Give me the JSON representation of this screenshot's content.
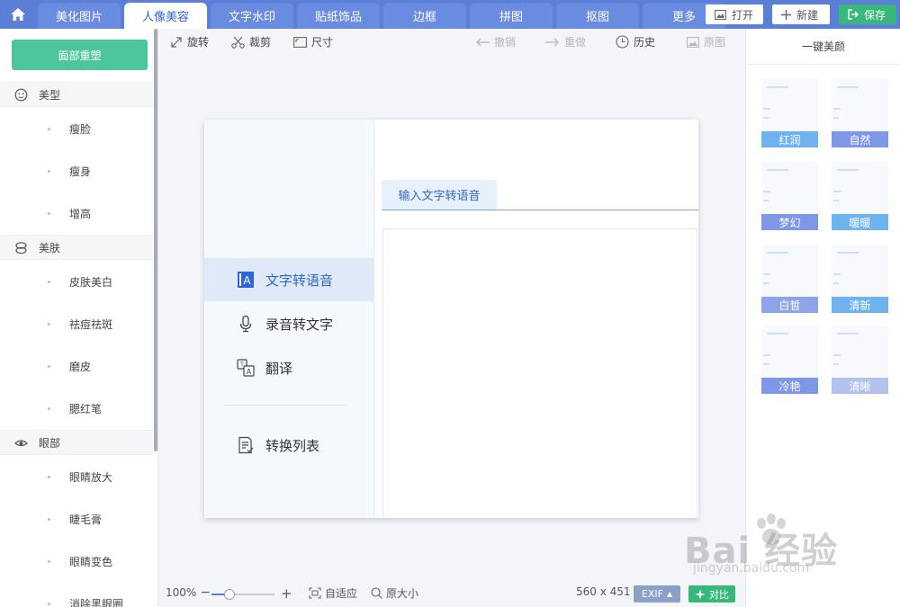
{
  "header": {
    "tabs": [
      "美化图片",
      "人像美容",
      "文字水印",
      "贴纸饰品",
      "边框",
      "拼图",
      "抠图",
      "更多"
    ],
    "active_tab_index": 1,
    "open_label": "打开",
    "new_label": "新建",
    "save_label": "保存"
  },
  "sidebar": {
    "reset_label": "面部重塑",
    "sections": [
      {
        "title": "美型",
        "icon": "face-icon",
        "items": [
          "瘦脸",
          "瘦身",
          "增高"
        ]
      },
      {
        "title": "美肤",
        "icon": "skin-icon",
        "items": [
          "皮肤美白",
          "祛痘祛斑",
          "磨皮",
          "腮红笔"
        ]
      },
      {
        "title": "眼部",
        "icon": "eye-icon",
        "items": [
          "眼睛放大",
          "睫毛膏",
          "眼睛变色",
          "消除黑眼圈"
        ]
      }
    ]
  },
  "toolbar": {
    "rotate": "旋转",
    "crop": "裁剪",
    "size": "尺寸",
    "undo": "撤销",
    "redo": "重做",
    "history": "历史",
    "original": "原图"
  },
  "canvas": {
    "menu": [
      "文字转语音",
      "录音转文字",
      "翻译",
      "转换列表"
    ],
    "active_menu_index": 0,
    "content_tab": "输入文字转语音"
  },
  "status": {
    "zoom": "100%",
    "fit": "自适应",
    "actual_size": "原大小",
    "dimensions": "560 x 451",
    "exif": "EXIF",
    "compare": "对比"
  },
  "right_panel": {
    "title": "一键美颜",
    "presets": [
      {
        "label": "红润",
        "color": "#6fb3ee"
      },
      {
        "label": "自然",
        "color": "#7e97e6"
      },
      {
        "label": "梦幻",
        "color": "#7e97e6"
      },
      {
        "label": "暖暖",
        "color": "#6fb3ee"
      },
      {
        "label": "白皙",
        "color": "#8ea4e8"
      },
      {
        "label": "清新",
        "color": "#6fb3ee"
      },
      {
        "label": "冷艳",
        "color": "#7e97e6"
      },
      {
        "label": "清晰",
        "color": "#b3c2ec"
      }
    ]
  },
  "watermark": {
    "brand": "Bai 经验",
    "url": "jingyan.baidu.com"
  },
  "colors": {
    "header": "#5b7ed6",
    "accent": "#2f66d6",
    "green": "#37b87a",
    "reset": "#4ec69b"
  }
}
